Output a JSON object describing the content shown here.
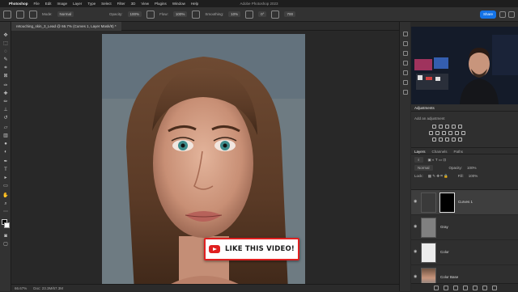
{
  "menubar": {
    "items": [
      "Photoshop",
      "File",
      "Edit",
      "Image",
      "Layer",
      "Type",
      "Select",
      "Filter",
      "3D",
      "View",
      "Plugins",
      "Window",
      "Help"
    ],
    "window_title": "Adobe Photoshop 2023"
  },
  "options_bar": {
    "mode_label": "Mode:",
    "mode_value": "Normal",
    "opacity_label": "Opacity:",
    "opacity_value": "100%",
    "flow_label": "Flow:",
    "flow_value": "100%",
    "smoothing_label": "Smoothing:",
    "smoothing_value": "10%",
    "angle_value": "0°",
    "share_label": "Share",
    "size_value": "700"
  },
  "document": {
    "tab_label": "retouching_skin_3_Lead @ 66.7% (Curves 1, Layer Mask/8) *",
    "zoom": "66.67%",
    "doc_info": "Doc: 23.3M/67.3M"
  },
  "panels": {
    "adjustments_tab": "Adjustments",
    "add_adjustment_label": "Add an adjustment",
    "layers_tabs": [
      "Layers",
      "Channels",
      "Paths"
    ],
    "blend_mode": "Normal",
    "layer_opacity_label": "Opacity:",
    "layer_opacity": "100%",
    "fill_label": "Fill:",
    "fill_value": "100%",
    "lock_label": "Lock:",
    "layers": [
      {
        "name": "Curves 1",
        "selected": true
      },
      {
        "name": "Gray",
        "selected": false
      },
      {
        "name": "Color",
        "selected": false
      },
      {
        "name": "Color Base",
        "selected": false
      }
    ]
  },
  "overlay": {
    "cta_text": "LIKE THIS VIDEO!"
  }
}
